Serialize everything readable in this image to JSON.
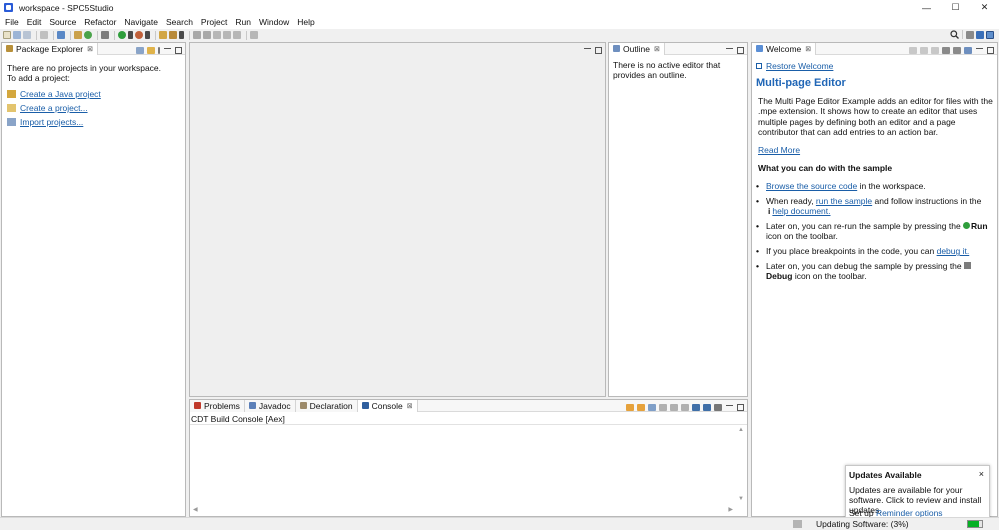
{
  "window": {
    "title": "workspace - SPC5Studio",
    "minimize": "—",
    "maximize": "☐",
    "close": "✕"
  },
  "menu": [
    "File",
    "Edit",
    "Source",
    "Refactor",
    "Navigate",
    "Search",
    "Project",
    "Run",
    "Window",
    "Help"
  ],
  "package_explorer": {
    "tab_label": "Package Explorer",
    "line1": "There are no projects in your workspace.",
    "line2": "To add a project:",
    "links": [
      "Create a Java project",
      "Create a project...",
      "Import projects..."
    ]
  },
  "outline": {
    "tab_label": "Outline",
    "message": "There is no active editor that provides an outline."
  },
  "welcome": {
    "tab_label": "Welcome",
    "restore": "Restore Welcome",
    "heading": "Multi-page Editor",
    "intro": "The Multi Page Editor Example adds an editor for files with the .mpe extension. It shows how to create an editor that uses multiple pages by defining both an editor and a page contributor that can add entries to an action bar.",
    "read_more": "Read More",
    "subheading": "What you can do with the sample",
    "item1_link": "Browse the source code",
    "item1_rest": " in the workspace.",
    "item2_pre": "When ready, ",
    "item2_link": "run the sample",
    "item2_mid": " and follow instructions in the ",
    "item2_icon": "i",
    "item2_link2": "help document.",
    "item3_pre": "Later on, you can re-run the sample by pressing the ",
    "item3_bold": "Run",
    "item3_post": " icon on the toolbar.",
    "item4_pre": "If you place breakpoints in the code, you can ",
    "item4_link": "debug it.",
    "item5_pre": "Later on, you can debug the sample by pressing the ",
    "item5_bold": "Debug",
    "item5_post": " icon on the toolbar."
  },
  "bottom": {
    "tabs": [
      "Problems",
      "Javadoc",
      "Declaration",
      "Console"
    ],
    "console_title": "CDT Build Console [Aex]"
  },
  "popup": {
    "title": "Updates Available",
    "close": "×",
    "body": "Updates are available for your software. Click to review and install updates.",
    "setup_pre": "Set up ",
    "setup_link": "Reminder options"
  },
  "status": {
    "progress_text": "Updating Software: (3%)",
    "progress": 0.03
  },
  "colors": {
    "accent": "#2066b6",
    "link": "#1a5ea8",
    "progress": "#06b025"
  }
}
